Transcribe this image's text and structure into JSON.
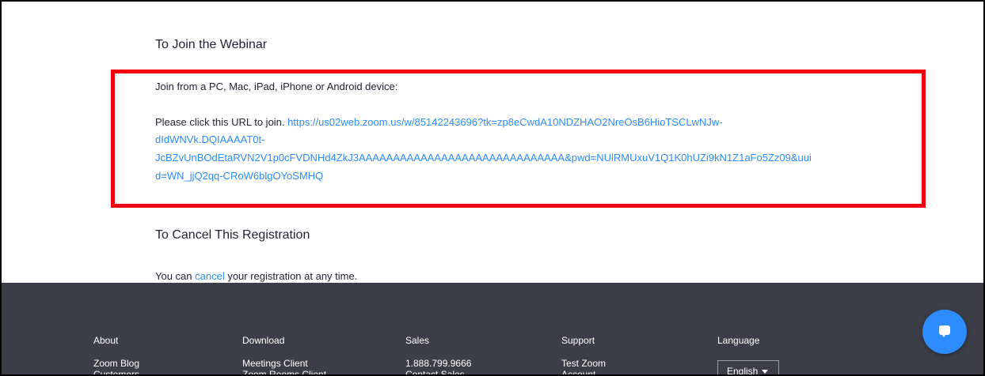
{
  "join": {
    "title": "To Join the Webinar",
    "device_line": "Join from a PC, Mac, iPad, iPhone or Android device:",
    "url_prefix": "Please click this URL to join. ",
    "url_lines": [
      "https://us02web.zoom.us/w/85142243696?tk=zp8eCwdA10NDZHAO2NreOsB6HioTSCLwNJw-",
      "dIdWNVk.DQIAAAAT0t-",
      "JcBZvUnBOdEtaRVN2V1p0cFVDNHd4ZkJ3AAAAAAAAAAAAAAAAAAAAAAAAAAAAAA&pwd=NUlRMUxuV1Q1K0hUZi9kN1Z1aFo5Zz09&uui",
      "d=WN_jjQ2qq-CRoW6blgOYoSMHQ"
    ]
  },
  "cancel": {
    "title": "To Cancel This Registration",
    "prefix": "You can ",
    "link": "cancel",
    "suffix": " your registration at any time."
  },
  "footer": {
    "columns": [
      {
        "heading": "About",
        "items": [
          "Zoom Blog",
          "Customers"
        ]
      },
      {
        "heading": "Download",
        "items": [
          "Meetings Client",
          "Zoom Rooms Client"
        ]
      },
      {
        "heading": "Sales",
        "items": [
          "1.888.799.9666",
          "Contact Sales"
        ]
      },
      {
        "heading": "Support",
        "items": [
          "Test Zoom",
          "Account"
        ]
      },
      {
        "heading": "Language",
        "items": []
      }
    ],
    "language_selected": "English"
  },
  "colors": {
    "accent": "#2d8cff",
    "highlight": "#f0000f",
    "footer_bg": "#3d3d4a"
  }
}
